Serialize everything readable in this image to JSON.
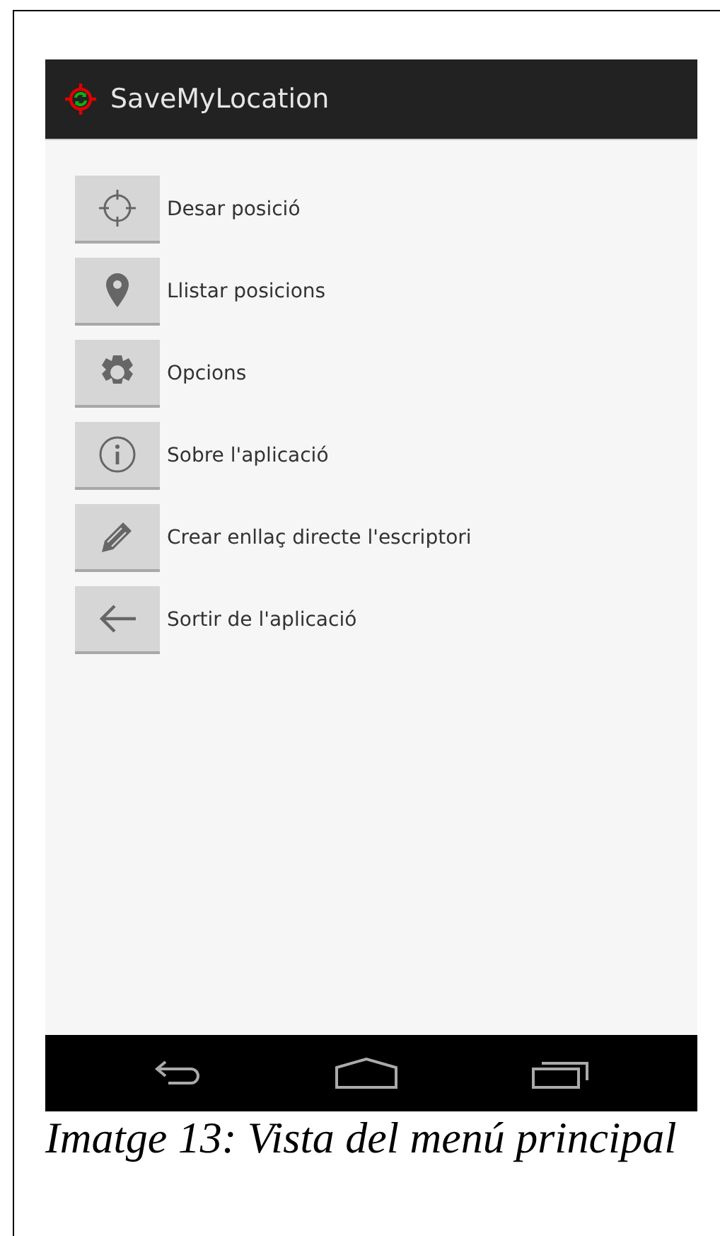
{
  "action_bar": {
    "title": "SaveMyLocation"
  },
  "menu_items": [
    {
      "label": "Desar posició"
    },
    {
      "label": "Llistar posicions"
    },
    {
      "label": "Opcions"
    },
    {
      "label": "Sobre l'aplicació"
    },
    {
      "label": "Crear enllaç directe l'escriptori"
    },
    {
      "label": "Sortir de l'aplicació"
    }
  ],
  "caption": "Imatge 13: Vista del menú principal"
}
